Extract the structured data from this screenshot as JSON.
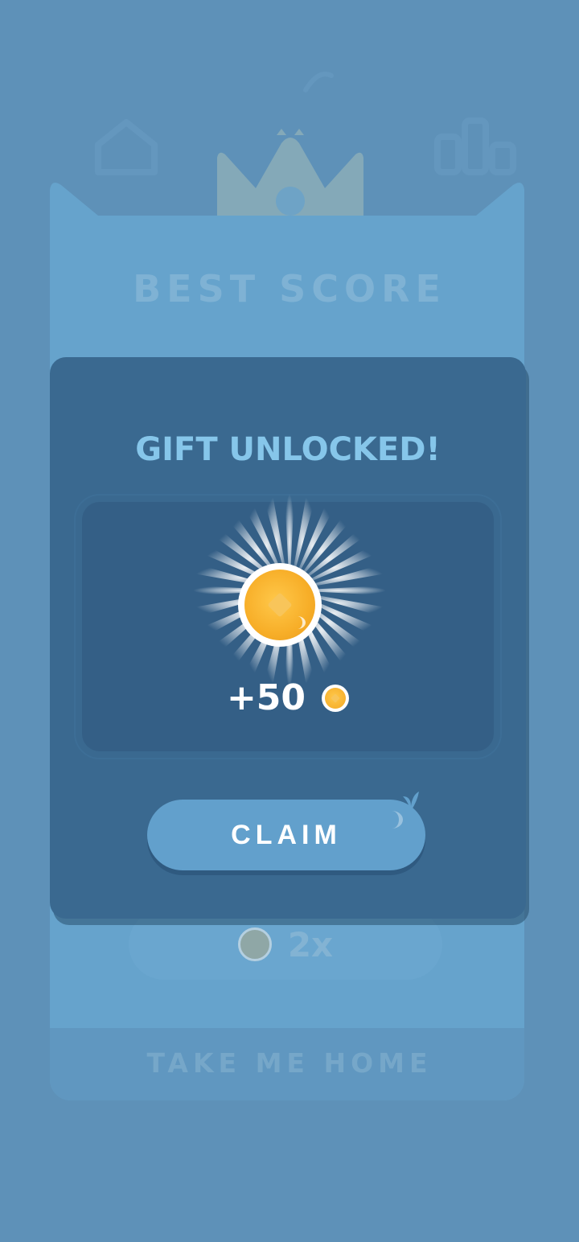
{
  "background": {
    "title": "BEST SCORE",
    "multiplier_label": "2x",
    "home_label": "TAKE ME HOME",
    "icons": [
      "home-icon",
      "crown-icon",
      "leaderboard-icon"
    ]
  },
  "modal": {
    "title": "GIFT UNLOCKED!",
    "reward_amount": "+50",
    "reward_icon": "coin-icon",
    "claim_label": "CLAIM"
  },
  "colors": {
    "backdrop": "#5e91b8",
    "modal": "#3a6990",
    "panel": "#345f86",
    "title": "#86c6ea",
    "button": "#62a0cc",
    "coin": "#f7ae28"
  }
}
